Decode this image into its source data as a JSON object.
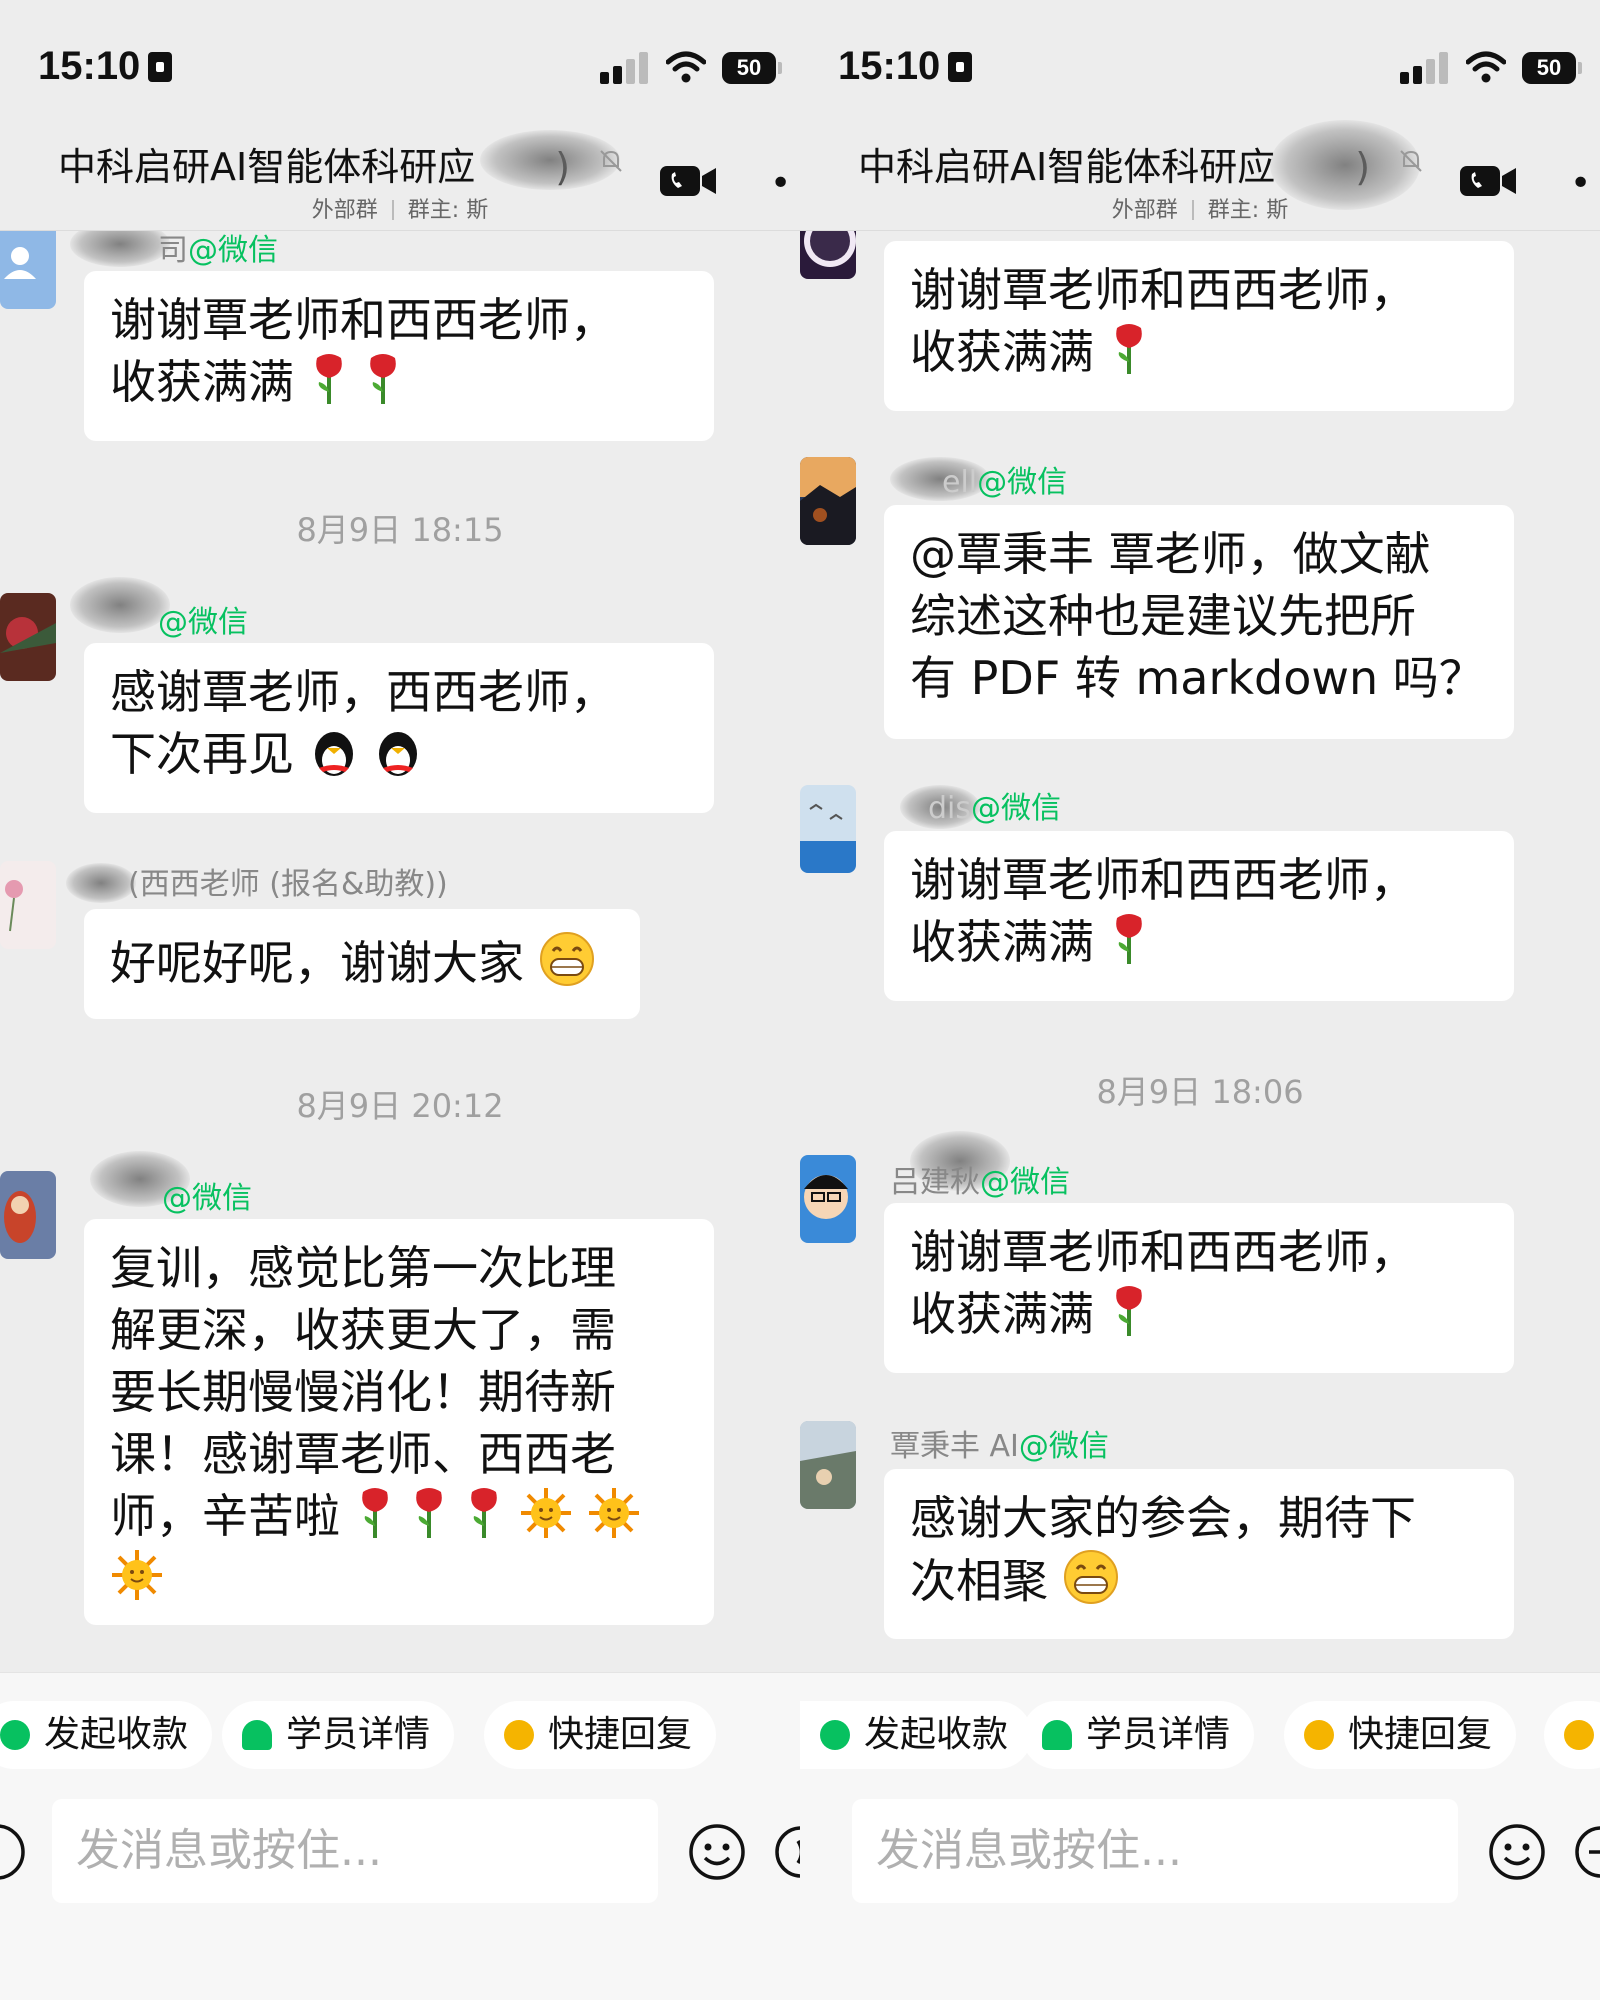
{
  "status": {
    "time": "15:10",
    "battery": "50"
  },
  "header": {
    "title": "中科启研AI智能体科研应",
    "title_suffix": ")",
    "group_type": "外部群",
    "owner": "群主: 斯"
  },
  "left": {
    "messages": [
      {
        "sender": "司",
        "wx": "@微信",
        "lines": [
          "谢谢覃老师和西西老师，",
          "收获满满"
        ]
      },
      {
        "time": "8月9日 18:15"
      },
      {
        "sender": "",
        "wx": "@微信",
        "lines": [
          "感谢覃老师，西西老师，",
          "下次再见"
        ]
      },
      {
        "sender": "(西西老师 (报名&助教))",
        "wx": "",
        "lines": [
          "好呢好呢，谢谢大家"
        ]
      },
      {
        "time": "8月9日 20:12"
      },
      {
        "sender": "",
        "wx": "@微信",
        "lines": [
          "复训，感觉比第一次比理",
          "解更深，收获更大了，需",
          "要长期慢慢消化！期待新",
          "课！感谢覃老师、西西老",
          "师，辛苦啦"
        ]
      }
    ]
  },
  "right": {
    "messages": [
      {
        "sender": "",
        "wx": "",
        "lines": [
          "谢谢覃老师和西西老师，",
          "收获满满"
        ]
      },
      {
        "sender": "ell",
        "wx": "@微信",
        "lines": [
          "@覃秉丰 覃老师，做文献",
          "综述这种也是建议先把所",
          "有 PDF 转 markdown 吗？"
        ]
      },
      {
        "sender": "dis",
        "wx": "@微信",
        "lines": [
          "谢谢覃老师和西西老师，",
          "收获满满"
        ]
      },
      {
        "time": "8月9日 18:06"
      },
      {
        "sender": "吕建秋",
        "wx": "@微信",
        "lines": [
          "谢谢覃老师和西西老师，",
          "收获满满"
        ]
      },
      {
        "sender": "覃秉丰 AI",
        "wx": "@微信",
        "lines": [
          "感谢大家的参会，期待下",
          "次相聚"
        ]
      }
    ]
  },
  "toolbar": {
    "chips": [
      "发起收款",
      "学员详情",
      "快捷回复"
    ],
    "input_placeholder": "发消息或按住..."
  },
  "icons": [
    "lock-icon",
    "signal-icon",
    "wifi-icon",
    "mute-bell-icon",
    "video-call-icon",
    "more-icon",
    "rose-emoji",
    "penguin-emoji",
    "grin-emoji",
    "sun-emoji",
    "voice-icon",
    "emoji-icon",
    "plus-icon"
  ],
  "colors": {
    "wechat_green": "#07c160",
    "background": "#ededed",
    "bubble": "#ffffff"
  }
}
